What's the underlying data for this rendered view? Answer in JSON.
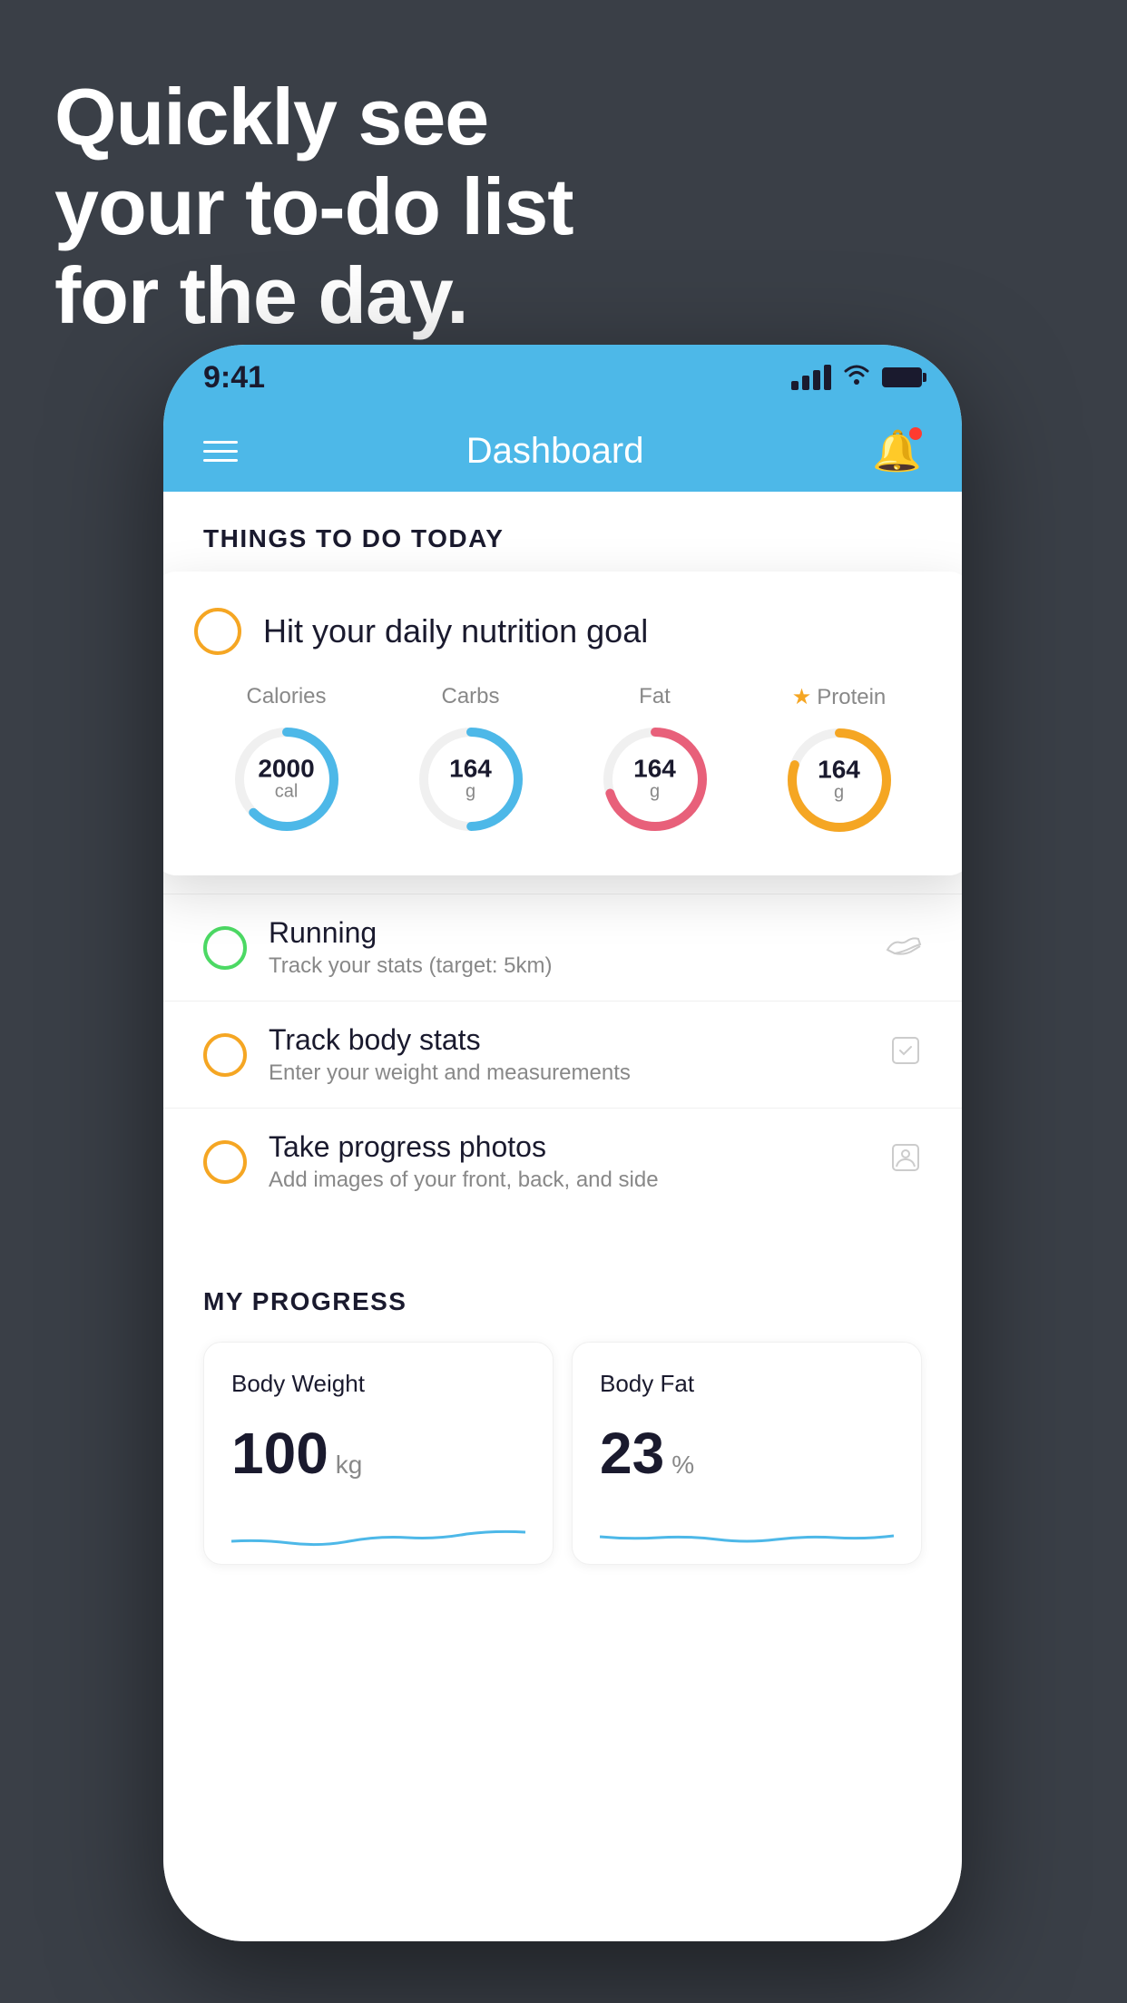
{
  "headline": {
    "line1": "Quickly see",
    "line2": "your to-do list",
    "line3": "for the day."
  },
  "status_bar": {
    "time": "9:41"
  },
  "nav": {
    "title": "Dashboard"
  },
  "things_section": {
    "header": "THINGS TO DO TODAY"
  },
  "nutrition_card": {
    "checkbox_state": "empty",
    "title": "Hit your daily nutrition goal",
    "items": [
      {
        "label": "Calories",
        "value": "2000",
        "unit": "cal",
        "color": "#4db8e8",
        "progress": 0.65,
        "starred": false
      },
      {
        "label": "Carbs",
        "value": "164",
        "unit": "g",
        "color": "#4db8e8",
        "progress": 0.5,
        "starred": false
      },
      {
        "label": "Fat",
        "value": "164",
        "unit": "g",
        "color": "#e8607a",
        "progress": 0.7,
        "starred": false
      },
      {
        "label": "Protein",
        "value": "164",
        "unit": "g",
        "color": "#f5a623",
        "progress": 0.8,
        "starred": true
      }
    ]
  },
  "todo_items": [
    {
      "id": "running",
      "title": "Running",
      "subtitle": "Track your stats (target: 5km)",
      "circle_color": "green",
      "icon": "shoe"
    },
    {
      "id": "track-body-stats",
      "title": "Track body stats",
      "subtitle": "Enter your weight and measurements",
      "circle_color": "yellow",
      "icon": "scale"
    },
    {
      "id": "progress-photos",
      "title": "Take progress photos",
      "subtitle": "Add images of your front, back, and side",
      "circle_color": "yellow",
      "icon": "person"
    }
  ],
  "progress_section": {
    "header": "MY PROGRESS",
    "cards": [
      {
        "title": "Body Weight",
        "value": "100",
        "unit": "kg"
      },
      {
        "title": "Body Fat",
        "value": "23",
        "unit": "%"
      }
    ]
  }
}
